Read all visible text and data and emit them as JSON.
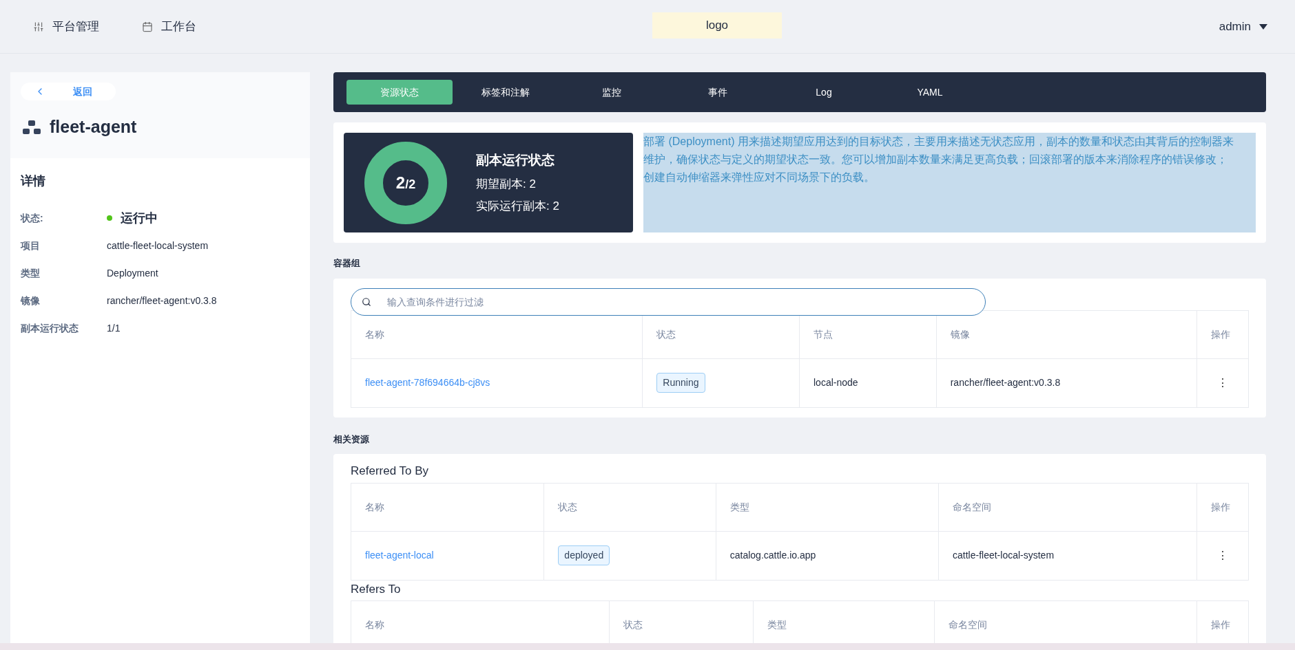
{
  "topbar": {
    "nav": [
      {
        "label": "平台管理"
      },
      {
        "label": "工作台"
      }
    ],
    "logo": "logo",
    "user": "admin"
  },
  "sidebar": {
    "back": "返回",
    "title": "fleet-agent",
    "details_title": "详情",
    "details": [
      {
        "label": "状态:",
        "value": "运行中",
        "kind": "status",
        "color": "#52c41a"
      },
      {
        "label": "项目",
        "value": "cattle-fleet-local-system",
        "kind": "text"
      },
      {
        "label": "类型",
        "value": "Deployment",
        "kind": "text"
      },
      {
        "label": "镜像",
        "value": "rancher/fleet-agent:v0.3.8",
        "kind": "text"
      },
      {
        "label": "副本运行状态",
        "value": "1/1",
        "kind": "text"
      }
    ]
  },
  "tabs": [
    {
      "label": "资源状态",
      "selected": true
    },
    {
      "label": "标签和注解",
      "selected": false
    },
    {
      "label": "监控",
      "selected": false
    },
    {
      "label": "事件",
      "selected": false
    },
    {
      "label": "Log",
      "selected": false
    },
    {
      "label": "YAML",
      "selected": false
    }
  ],
  "summary": {
    "ready": "2",
    "desired": "/2",
    "title": "副本运行状态",
    "lines": [
      "期望副本: 2",
      "实际运行副本: 2"
    ],
    "description": "部署 (Deployment) 用来描述期望应用达到的目标状态，主要用来描述无状态应用，副本的数量和状态由其背后的控制器来维护，确保状态与定义的期望状态一致。您可以增加副本数量来满足更高负载；回滚部署的版本来消除程序的错误修改；创建自动伸缩器来弹性应对不同场景下的负载。"
  },
  "pods": {
    "title": "容器组",
    "search": {
      "placeholder": "输入查询条件进行过滤"
    },
    "table": {
      "columns": [
        "名称",
        "状态",
        "节点",
        "镜像",
        "操作"
      ],
      "rows": [
        {
          "cells": [
            "fleet-agent-78f694664b-cj8vs",
            "Running",
            "local-node",
            "rancher/fleet-agent:v0.3.8",
            "⋮"
          ]
        }
      ]
    }
  },
  "related": {
    "title": "相关资源",
    "tables": [
      {
        "title": "Referred To By",
        "columns": [
          "名称",
          "状态",
          "类型",
          "命名空间",
          "操作"
        ],
        "rows": [
          {
            "cells": [
              "fleet-agent-local",
              "deployed",
              "catalog.cattle.io.app",
              "cattle-fleet-local-system",
              "⋮"
            ]
          }
        ]
      },
      {
        "title": "Refers To",
        "columns": [
          "名称",
          "状态",
          "类型",
          "命名空间",
          "操作"
        ]
      }
    ]
  }
}
